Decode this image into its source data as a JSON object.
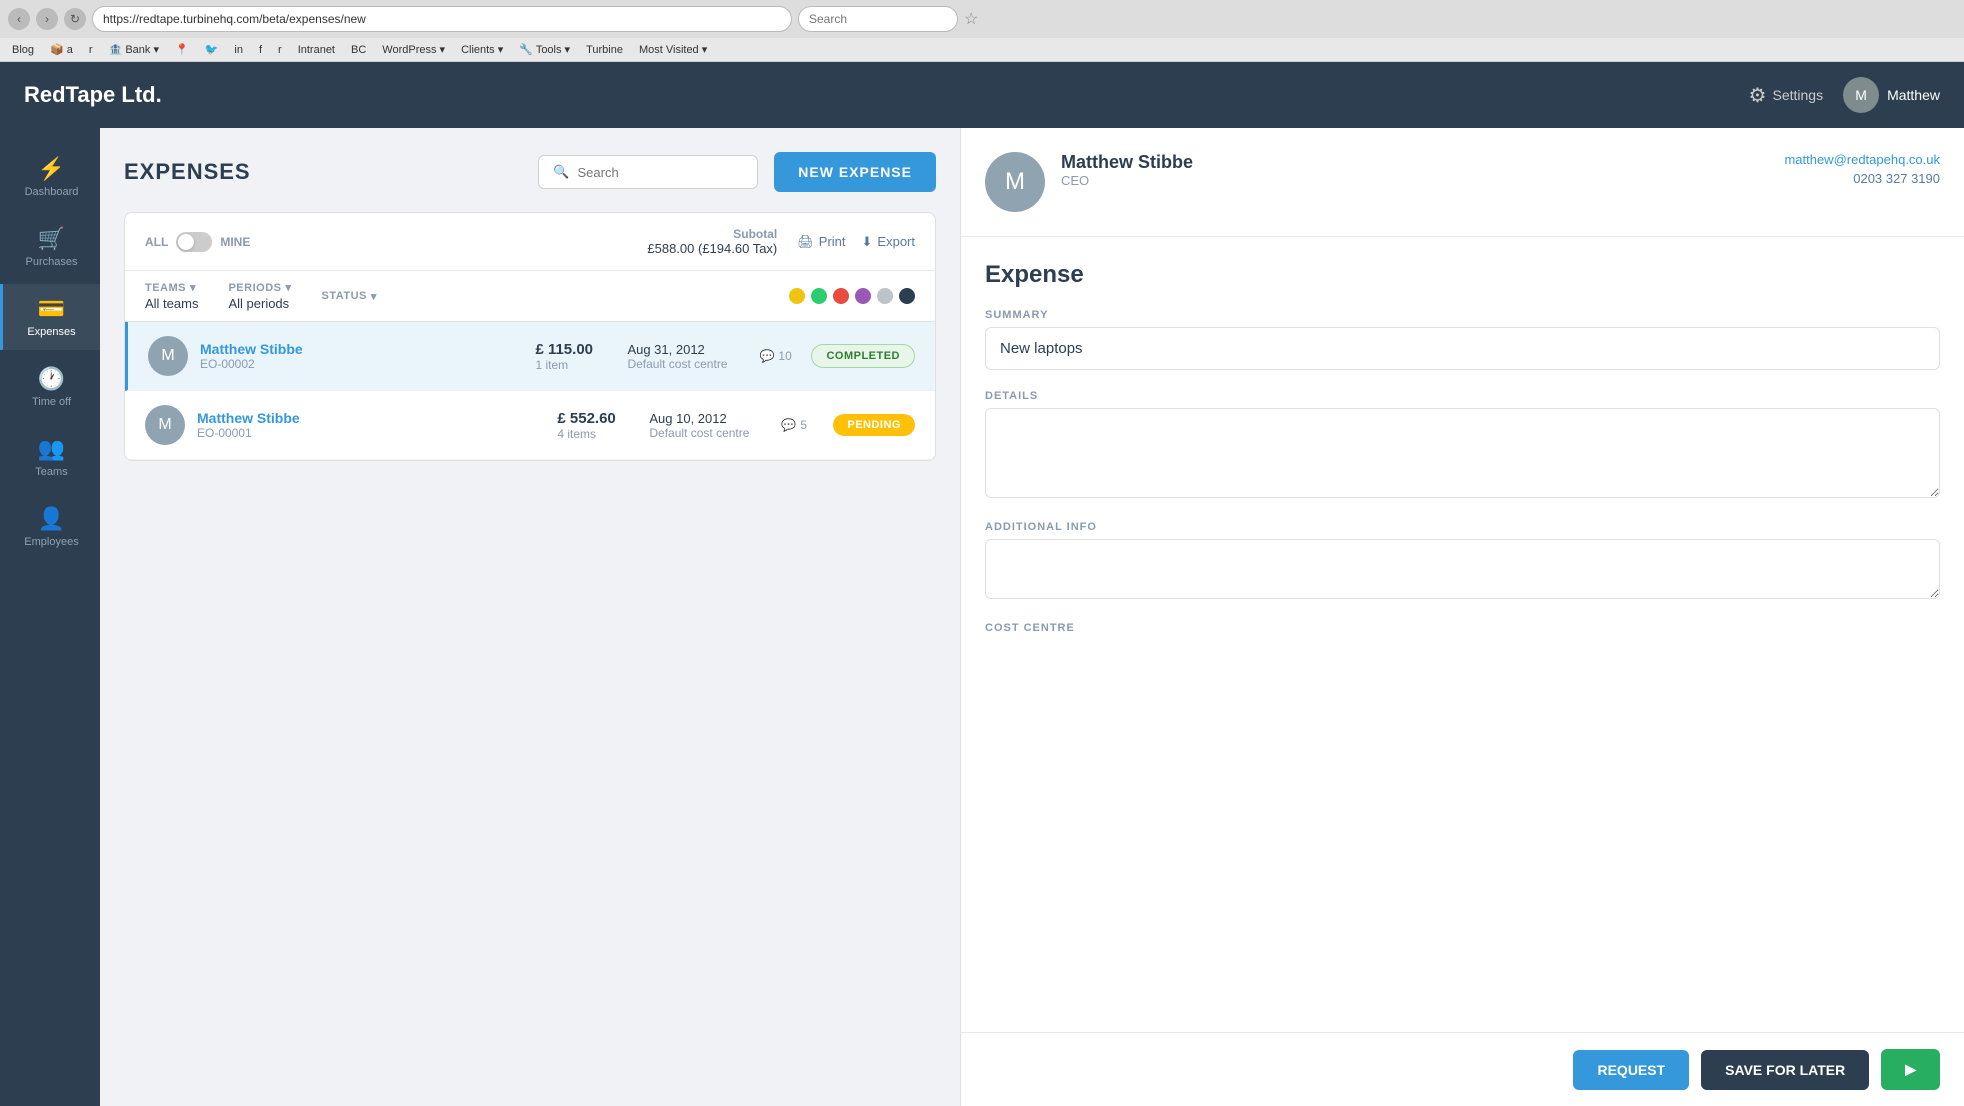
{
  "browser": {
    "url": "https://redtape.turbinehq.com/beta/expenses/new",
    "search_placeholder": "Search",
    "bookmarks": [
      "Blog",
      "a",
      "r",
      "Bank",
      "WordPress",
      "Clients",
      "Tools",
      "Turbine",
      "Most Visited"
    ]
  },
  "app": {
    "logo": "RedTape Ltd.",
    "header": {
      "settings_label": "Settings",
      "user_name": "Matthew"
    }
  },
  "sidebar": {
    "items": [
      {
        "id": "dashboard",
        "label": "Dashboard",
        "icon": "⚡"
      },
      {
        "id": "purchases",
        "label": "Purchases",
        "icon": "🛍"
      },
      {
        "id": "expenses",
        "label": "Expenses",
        "icon": "💳"
      },
      {
        "id": "timeoff",
        "label": "Time off",
        "icon": "🕐"
      },
      {
        "id": "teams",
        "label": "Teams",
        "icon": "👥"
      },
      {
        "id": "employees",
        "label": "Employees",
        "icon": "👤"
      }
    ]
  },
  "expenses": {
    "title": "EXPENSES",
    "search_placeholder": "Search",
    "new_expense_label": "NEW EXPENSE",
    "toggle_all": "ALL",
    "toggle_mine": "MINE",
    "subtotal_label": "Subotal",
    "subtotal_value": "£588.00 (£194.60 Tax)",
    "print_label": "Print",
    "export_label": "Export",
    "teams_filter_label": "TEAMS",
    "teams_filter_value": "All teams",
    "periods_filter_label": "PERIODS",
    "periods_filter_value": "All periods",
    "status_filter_label": "STATUS",
    "status_dots": [
      {
        "color": "#f1c40f"
      },
      {
        "color": "#2ecc71"
      },
      {
        "color": "#e74c3c"
      },
      {
        "color": "#9b59b6"
      },
      {
        "color": "#bdc3c7"
      },
      {
        "color": "#2c3e50"
      }
    ],
    "rows": [
      {
        "name": "Matthew Stibbe",
        "id": "EO-00002",
        "amount": "£ 115.00",
        "items": "1 item",
        "date": "Aug 31, 2012",
        "centre": "Default cost centre",
        "comments": "10",
        "status": "COMPLETED",
        "status_type": "completed",
        "selected": true
      },
      {
        "name": "Matthew Stibbe",
        "id": "EO-00001",
        "amount": "£ 552.60",
        "items": "4 items",
        "date": "Aug 10, 2012",
        "centre": "Default cost centre",
        "comments": "5",
        "status": "PENDING",
        "status_type": "pending",
        "selected": false
      }
    ]
  },
  "employee": {
    "name": "Matthew Stibbe",
    "role": "CEO",
    "email": "matthew@redtapehq.co.uk",
    "phone": "0203 327 3190"
  },
  "expense_form": {
    "title": "Expense",
    "summary_label": "SUMMARY",
    "summary_value": "New laptops",
    "details_label": "DETAILS",
    "details_placeholder": "",
    "additional_info_label": "ADDITIONAL INFO",
    "cost_centre_label": "COST CENTRE",
    "request_label": "REQUEST",
    "save_later_label": "SAVE FOR LATER"
  }
}
